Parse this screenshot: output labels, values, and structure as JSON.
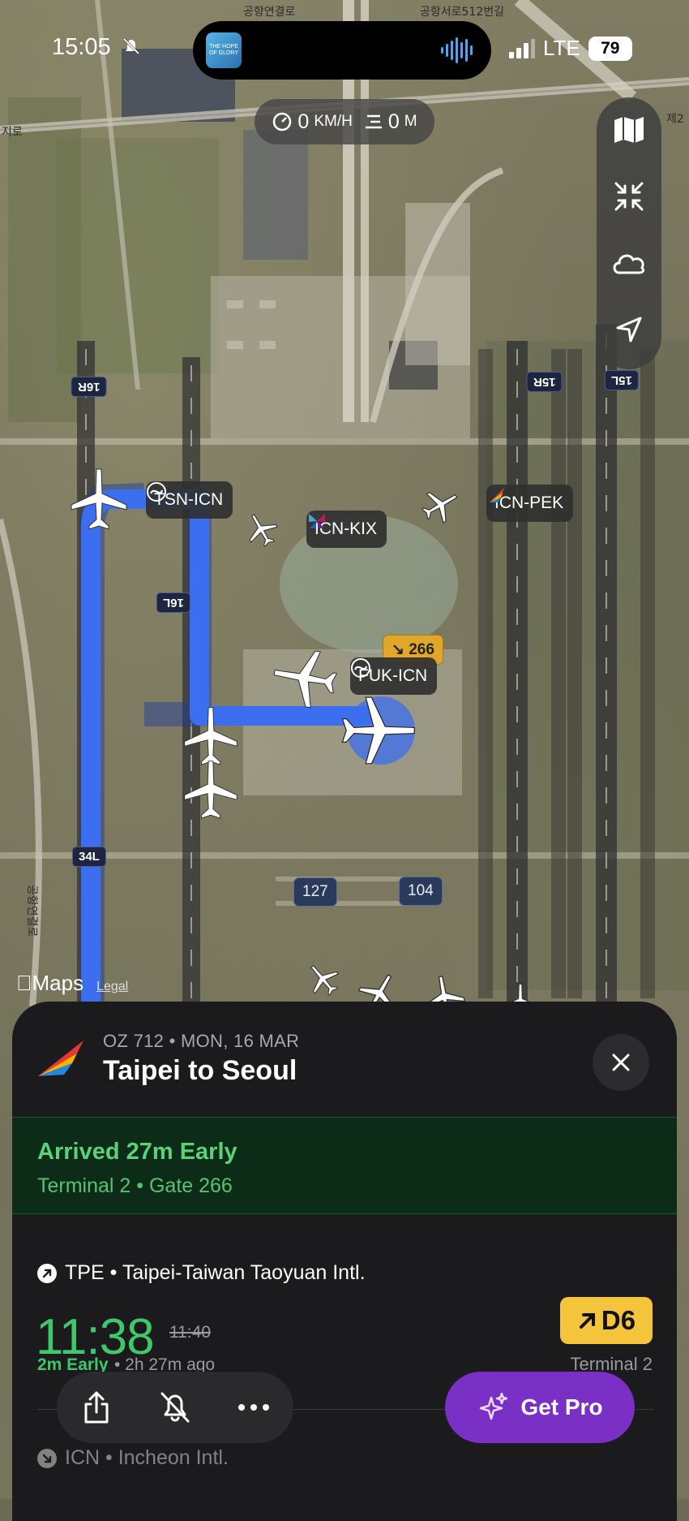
{
  "status_bar": {
    "time": "15:05",
    "network": "LTE",
    "battery": "79",
    "album_art_text": "THE HOPE OF GLORY"
  },
  "map": {
    "speed_value": "0",
    "speed_unit": "KM/H",
    "altitude_value": "0",
    "altitude_unit": "M",
    "streets": [
      "공항연결로",
      "공항서로512번길",
      "공항연결로",
      "제2",
      "지로"
    ],
    "runways": [
      "16R",
      "15R",
      "15L",
      "16L",
      "34L"
    ],
    "gates": [
      "266",
      "127",
      "104"
    ],
    "flight_labels": [
      "TSN-ICN",
      "ICN-KIX",
      "ICN-PEK",
      "FUK-ICN"
    ],
    "credit_brand": "Maps",
    "legal_link": "Legal",
    "route_color": "#3b6ff0"
  },
  "toolbar": {
    "icons": [
      "map-icon",
      "collapse-icon",
      "weather-cloud-icon",
      "location-arrow-icon"
    ]
  },
  "flight": {
    "meta": "OZ 712 • MON, 16 MAR",
    "title": "Taipei to Seoul",
    "arrival_status": "Arrived 27m Early",
    "arrival_detail": "Terminal 2 • Gate 266",
    "origin": "TPE • Taipei-Taiwan Taoyuan Intl.",
    "departure_time": "11:38",
    "departure_scheduled": "11:40",
    "departure_early": "2m Early",
    "departure_ago": "• 2h 27m ago",
    "departure_gate": "D6",
    "departure_terminal": "Terminal 2",
    "destination": "ICN • Incheon Intl."
  },
  "actions": {
    "get_pro_label": "Get Pro"
  },
  "colors": {
    "early_green": "#3fc86a",
    "gate_yellow": "#f4c53a",
    "pro_purple": "#7a2fc5"
  }
}
